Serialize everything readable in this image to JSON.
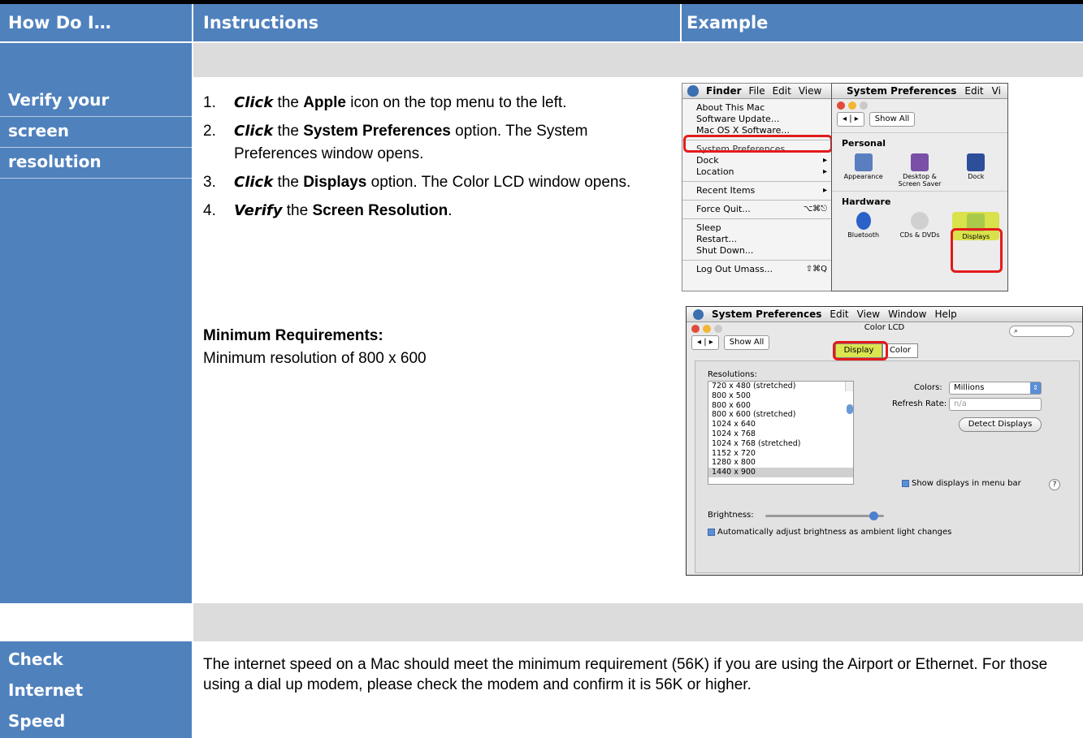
{
  "header": {
    "col1": "How Do I…",
    "col2": "Instructions",
    "col3": "Example"
  },
  "sections": [
    {
      "title_lines": [
        "Verify your",
        "screen",
        "resolution"
      ],
      "steps": [
        {
          "num": "1.",
          "verb": "Click",
          "pre": " the ",
          "bold": "Apple",
          "post": " icon on the top menu to the left."
        },
        {
          "num": "2.",
          "verb": "Click",
          "pre": " the ",
          "bold": "System Preferences",
          "post": " option. The System Preferences window opens."
        },
        {
          "num": "3.",
          "verb": "Click",
          "pre": " the ",
          "bold": "Displays",
          "post": " option.  The Color LCD window opens."
        },
        {
          "num": "4.",
          "verb": "Verify",
          "pre": " the ",
          "bold": "Screen Resolution",
          "post": "."
        }
      ],
      "requirements_title": "Minimum Requirements:",
      "requirements_text": "Minimum resolution of 800 x 600"
    },
    {
      "title_lines": [
        "Check",
        "Internet",
        "Speed"
      ],
      "text": "The internet speed on a Mac should meet the minimum requirement (56K) if you are using the Airport or Ethernet.  For those using a dial up modem, please check the modem and confirm it is 56K or higher."
    }
  ],
  "finder_menu": {
    "menubar": [
      "Finder",
      "File",
      "Edit",
      "View"
    ],
    "items": [
      {
        "label": "About This Mac",
        "shortcut": ""
      },
      {
        "label": "Software Update...",
        "shortcut": ""
      },
      {
        "label": "Mac OS X Software...",
        "shortcut": ""
      },
      {
        "label": "System Preferences...",
        "shortcut": ""
      },
      {
        "label": "Dock",
        "shortcut": "▸"
      },
      {
        "label": "Location",
        "shortcut": "▸"
      },
      {
        "label": "Recent Items",
        "shortcut": "▸"
      },
      {
        "label": "Force Quit...",
        "shortcut": "⌥⌘⎋"
      },
      {
        "label": "Sleep",
        "shortcut": ""
      },
      {
        "label": "Restart...",
        "shortcut": ""
      },
      {
        "label": "Shut Down...",
        "shortcut": ""
      },
      {
        "label": "Log Out Umass...",
        "shortcut": "⇧⌘Q"
      }
    ]
  },
  "sysprefs": {
    "menubar": [
      "System Preferences",
      "Edit",
      "Vi"
    ],
    "show_all": "Show All",
    "personal": "Personal",
    "personal_icons": [
      "Appearance",
      "Desktop & Screen Saver",
      "Dock"
    ],
    "hardware": "Hardware",
    "hardware_icons": [
      "Bluetooth",
      "CDs & DVDs",
      "Displays"
    ]
  },
  "color_lcd": {
    "menubar": [
      "System Preferences",
      "Edit",
      "View",
      "Window",
      "Help"
    ],
    "window_title": "Color LCD",
    "show_all": "Show All",
    "tab_display": "Display",
    "tab_color": "Color",
    "resolutions_label": "Resolutions:",
    "resolutions": [
      "720 x 480 (stretched)",
      "800 x 500",
      "800 x 600",
      "800 x 600 (stretched)",
      "1024 x 640",
      "1024 x 768",
      "1024 x 768 (stretched)",
      "1152 x 720",
      "1280 x 800",
      "1440 x 900"
    ],
    "selected_resolution": "1440 x 900",
    "colors_label": "Colors:",
    "colors_value": "Millions",
    "refresh_label": "Refresh Rate:",
    "refresh_value": "n/a",
    "detect_button": "Detect Displays",
    "show_in_menu_bar": "Show displays in menu bar",
    "help": "?",
    "brightness_label": "Brightness:",
    "brightness_level": 0.95,
    "auto_brightness": "Automatically adjust brightness as ambient light changes"
  }
}
